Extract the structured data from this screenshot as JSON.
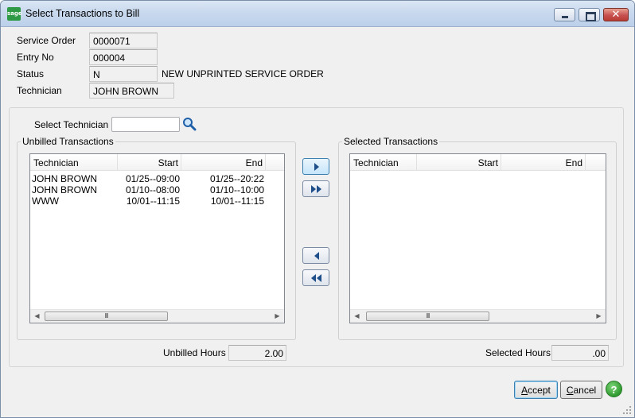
{
  "window": {
    "title": "Select Transactions to Bill",
    "app_icon": "sage"
  },
  "header": {
    "service_order_label": "Service Order",
    "service_order_value": "0000071",
    "entry_no_label": "Entry No",
    "entry_no_value": "000004",
    "status_label": "Status",
    "status_value": "N",
    "status_description": "NEW UNPRINTED SERVICE ORDER",
    "technician_label": "Technician",
    "technician_value": "JOHN BROWN"
  },
  "filter": {
    "select_technician_label": "Select Technician",
    "select_technician_value": ""
  },
  "unbilled": {
    "title": "Unbilled Transactions",
    "columns": [
      "Technician",
      "Start",
      "End"
    ],
    "rows": [
      [
        "JOHN BROWN",
        "01/25--09:00",
        "01/25--20:22"
      ],
      [
        "JOHN BROWN",
        "01/10--08:00",
        "01/10--10:00"
      ],
      [
        "WWW",
        "10/01--11:15",
        "10/01--11:15"
      ]
    ],
    "hours_label": "Unbilled Hours",
    "hours_value": "2.00"
  },
  "selected": {
    "title": "Selected Transactions",
    "columns": [
      "Technician",
      "Start",
      "End"
    ],
    "rows": [],
    "hours_label": "Selected Hours",
    "hours_value": ".00"
  },
  "scrollbar": {
    "left_arrow": "◀",
    "right_arrow": "▶",
    "thumb_grip": "III"
  },
  "footer": {
    "accept_label": "Accept",
    "accept_mnemonic": "A",
    "accept_rest": "ccept",
    "cancel_label": "Cancel",
    "cancel_mnemonic": "C",
    "cancel_rest": "ancel",
    "help_label": "?"
  },
  "colors": {
    "title_bar": "#c9d9ee",
    "window_bg": "#f0f0f0",
    "close_button": "#c75050",
    "help_button": "#2f9a2f",
    "arrow_icon": "#1f4f8a"
  }
}
